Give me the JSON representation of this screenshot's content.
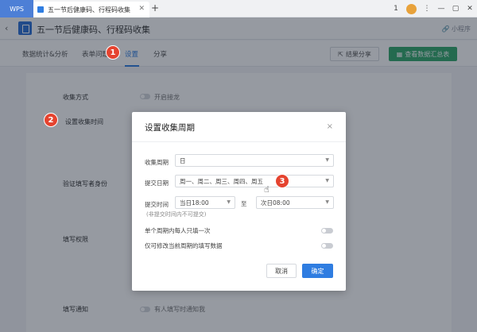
{
  "titlebar": {
    "wps_label": "WPS",
    "doc_tab_title": "五一节后健康码、行程码收集",
    "new_tab": "+",
    "window_box": "1"
  },
  "header": {
    "back": "‹",
    "title": "五一节后健康码、行程码收集",
    "mini_program": "小程序"
  },
  "tabs": [
    {
      "label": "数据统计&分析"
    },
    {
      "label": "表单问题"
    },
    {
      "label": "设置"
    },
    {
      "label": "分享"
    }
  ],
  "toolbar": {
    "share_label": "结果分享",
    "summary_label": "查看数据汇总表"
  },
  "settings": {
    "collect_mode_label": "收集方式",
    "collect_mode_toggle": "开启接龙",
    "collect_time_label": "设置收集时间",
    "verify_label": "验证填写者身份",
    "permission_label": "填写权限",
    "notify_label": "填写通知",
    "notify_toggle": "有人填写时通知我"
  },
  "modal": {
    "title": "设置收集周期",
    "close": "×",
    "cycle_label": "收集周期",
    "cycle_value": "日",
    "submit_date_label": "提交日期",
    "submit_date_value": "周一、周二、周三、周四、周五",
    "submit_time_label": "提交时间",
    "start_time": "当日18:00",
    "to": "至",
    "end_time": "次日08:00",
    "hint": "(非提交时间内不可提交)",
    "once_label": "单个周期内每人只填一次",
    "editable_label": "仅可修改当前周期的填写数据",
    "cancel_label": "取消",
    "ok_label": "确定"
  },
  "callouts": [
    "1",
    "2",
    "3"
  ],
  "colors": {
    "accent": "#2f7de1",
    "green": "#31a86b",
    "callout": "#e5432f"
  }
}
